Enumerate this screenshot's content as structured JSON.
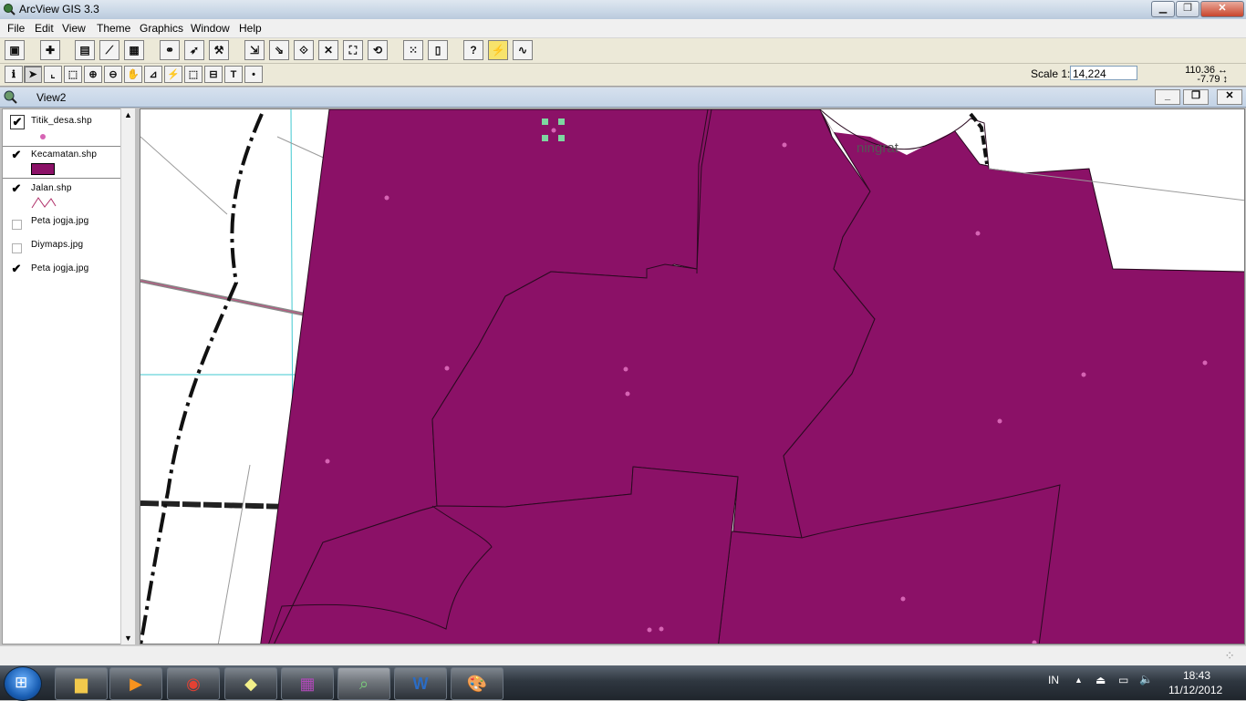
{
  "app": {
    "title": "ArcView GIS 3.3"
  },
  "menu": [
    "File",
    "Edit",
    "View",
    "Theme",
    "Graphics",
    "Window",
    "Help"
  ],
  "scale": {
    "label": "Scale 1:",
    "value": "14,224"
  },
  "coords": {
    "x": "110.36",
    "y": "-7.79"
  },
  "view": {
    "title": "View2"
  },
  "layers": [
    {
      "name": "Titik_desa.shp",
      "checked": true
    },
    {
      "name": "Kecamatan.shp",
      "checked": true
    },
    {
      "name": "Jalan.shp",
      "checked": true
    },
    {
      "name": "Peta jogja.jpg",
      "checked": false
    },
    {
      "name": "Diymaps.jpg",
      "checked": false
    },
    {
      "name": "Peta jogja.jpg",
      "checked": true
    }
  ],
  "colors": {
    "polygon": "#8b1167",
    "point": "#d664b4",
    "selection": "#7ed6a0"
  },
  "map_labels": {
    "place": "ningrat"
  },
  "tray": {
    "lang": "IN",
    "time": "18:43",
    "date": "11/12/2012"
  },
  "icons": {
    "buttonbar": [
      "save-icon",
      "add-theme-icon",
      "theme-properties-icon",
      "edit-legend-icon",
      "open-table-icon",
      "find-icon",
      "locate-icon",
      "query-icon",
      "zoom-full-icon",
      "zoom-active-icon",
      "zoom-selected-icon",
      "zoom-in-fixed-icon",
      "zoom-out-fixed-icon",
      "zoom-previous-icon",
      "select-none-icon",
      "layout-icon",
      "help-icon",
      "hotlink-icon",
      "draw-icon"
    ],
    "tools": [
      "identify-icon",
      "pointer-icon",
      "vertex-edit-icon",
      "select-feature-icon",
      "zoom-in-icon",
      "zoom-out-icon",
      "pan-icon",
      "measure-icon",
      "hotlink-tool-icon",
      "area-select-icon",
      "label-icon",
      "text-icon",
      "point-draw-icon"
    ]
  }
}
